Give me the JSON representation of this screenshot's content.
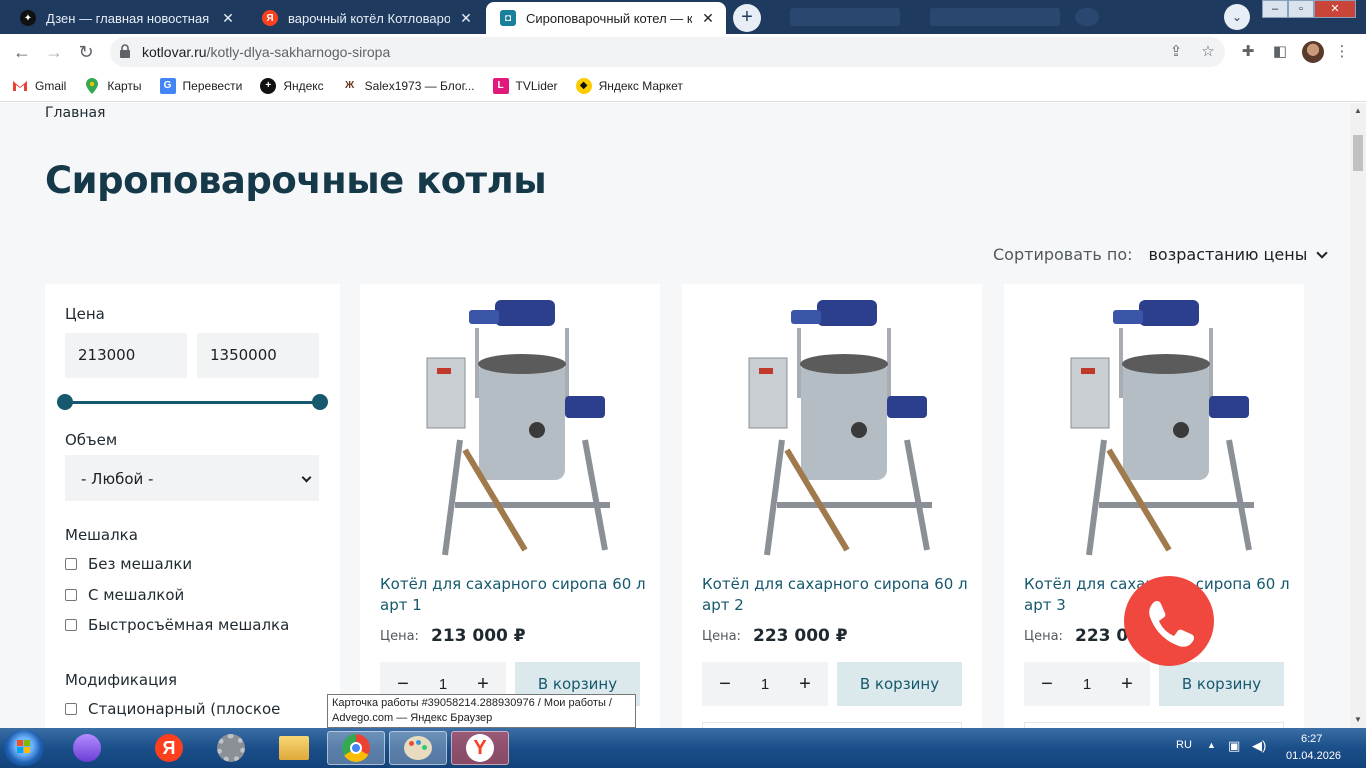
{
  "browser": {
    "tabs": [
      {
        "title": "Дзен — главная новостная инф",
        "active": false,
        "favicon": "dzen-icon"
      },
      {
        "title": "варочный котёл Котловаров —",
        "active": false,
        "favicon": "yandex-icon"
      },
      {
        "title": "Сироповарочный котел — купи",
        "active": true,
        "favicon": "site-icon"
      }
    ],
    "url_host": "kotlovar.ru",
    "url_path": "/kotly-dlya-sakharnogo-siropa",
    "bookmarks": [
      {
        "label": "Gmail",
        "icon": "gmail-icon"
      },
      {
        "label": "Карты",
        "icon": "maps-icon"
      },
      {
        "label": "Перевести",
        "icon": "translate-icon"
      },
      {
        "label": "Яндекс",
        "icon": "yandex-plus-icon"
      },
      {
        "label": "Salex1973 — Блог...",
        "icon": "blog-icon"
      },
      {
        "label": "TVLider",
        "icon": "tvlider-icon"
      },
      {
        "label": "Яндекс Маркет",
        "icon": "market-icon"
      }
    ]
  },
  "page": {
    "breadcrumb": "Главная",
    "title": "Сироповарочные котлы",
    "sort": {
      "label": "Сортировать по:",
      "value": "возрастанию цены"
    },
    "filters": {
      "price_heading": "Цена",
      "price_min": "213000",
      "price_max": "1350000",
      "volume_heading": "Объем",
      "volume_selected": "- Любой -",
      "mixer_heading": "Мешалка",
      "mixer_options": [
        "Без мешалки",
        "С мешалкой",
        "Быстросъёмная мешалка"
      ],
      "modification_heading": "Модификация",
      "modification_options": [
        "Стационарный (плоское"
      ]
    },
    "products": [
      {
        "name": "Котёл для сахарного сиропа 60 л арт 1",
        "price_label": "Цена:",
        "price": "213 000 ₽",
        "qty": "1",
        "cart_label": "В корзину"
      },
      {
        "name": "Котёл для сахарного сиропа 60 л арт 2",
        "price_label": "Цена:",
        "price": "223 000 ₽",
        "qty": "1",
        "cart_label": "В корзину"
      },
      {
        "name": "Котёл для сахарного сиропа 60 л арт 3",
        "price_label": "Цена:",
        "price": "223 000 ₽",
        "qty": "1",
        "cart_label": "В корзину"
      }
    ],
    "call_button_color": "#f0483e",
    "accent_color": "#16596e"
  },
  "tooltip": {
    "line1": "Карточка работы #39058214.288930976 / Мои работы /",
    "line2": "Advego.com — Яндекс Браузер"
  },
  "taskbar": {
    "lang": "RU",
    "time": "6:27",
    "date": "01.04.2026"
  }
}
